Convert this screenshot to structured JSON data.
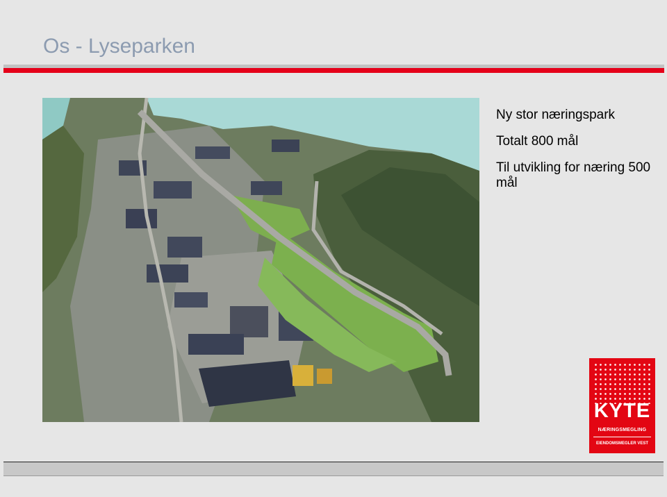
{
  "slide": {
    "title": "Os - Lyseparken"
  },
  "bullets": [
    "Ny stor næringspark",
    "Totalt 800 mål",
    "Til utvikling for næring 500 mål"
  ],
  "logo": {
    "name": "KYTE",
    "line1": "NÆRINGSMEGLING",
    "line2": "EIENDOMSMEGLER VEST"
  },
  "colors": {
    "accent_red": "#e5001a",
    "title_color": "#8c9bb0"
  }
}
